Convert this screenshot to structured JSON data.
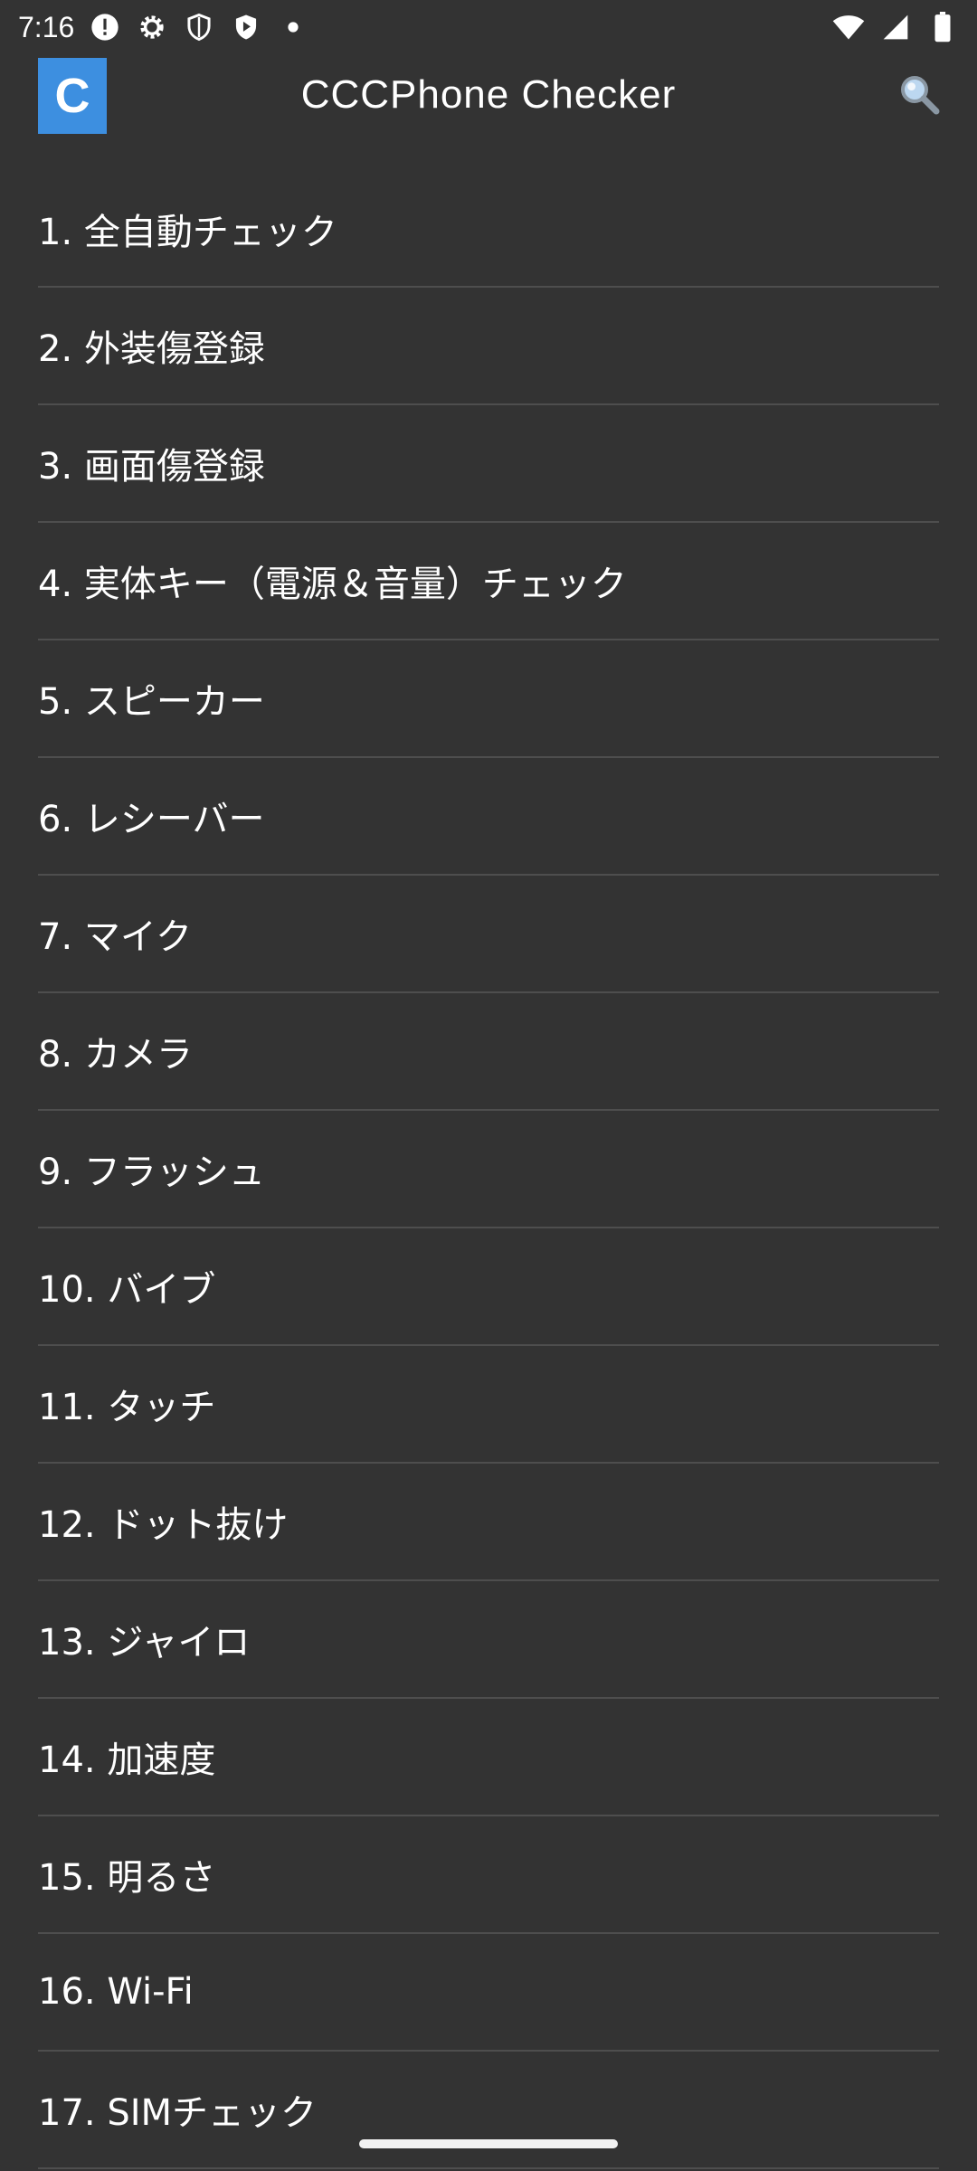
{
  "status_bar": {
    "time": "7:16"
  },
  "app_bar": {
    "logo_letter": "C",
    "title": "CCCPhone Checker"
  },
  "menu": {
    "items": [
      "1. 全自動チェック",
      "2. 外装傷登録",
      "3. 画面傷登録",
      "4. 実体キー（電源＆音量）チェック",
      "5. スピーカー",
      "6. レシーバー",
      "7. マイク",
      "8. カメラ",
      "9. フラッシュ",
      "10. バイブ",
      "11. タッチ",
      "12. ドット抜け",
      "13. ジャイロ",
      "14. 加速度",
      "15. 明るさ",
      "16. Wi-Fi",
      "17. SIMチェック"
    ]
  },
  "icons": {
    "status_left": [
      "alert-icon",
      "gear-icon",
      "shield-icon",
      "play-shield-icon",
      "dot-icon"
    ],
    "status_right": [
      "wifi-icon",
      "cell-signal-icon",
      "battery-icon"
    ],
    "search": "search-icon"
  },
  "colors": {
    "background": "#333333",
    "logo": "#3d8fe0",
    "divider": "#4e4e4e",
    "text": "#ffffff"
  }
}
